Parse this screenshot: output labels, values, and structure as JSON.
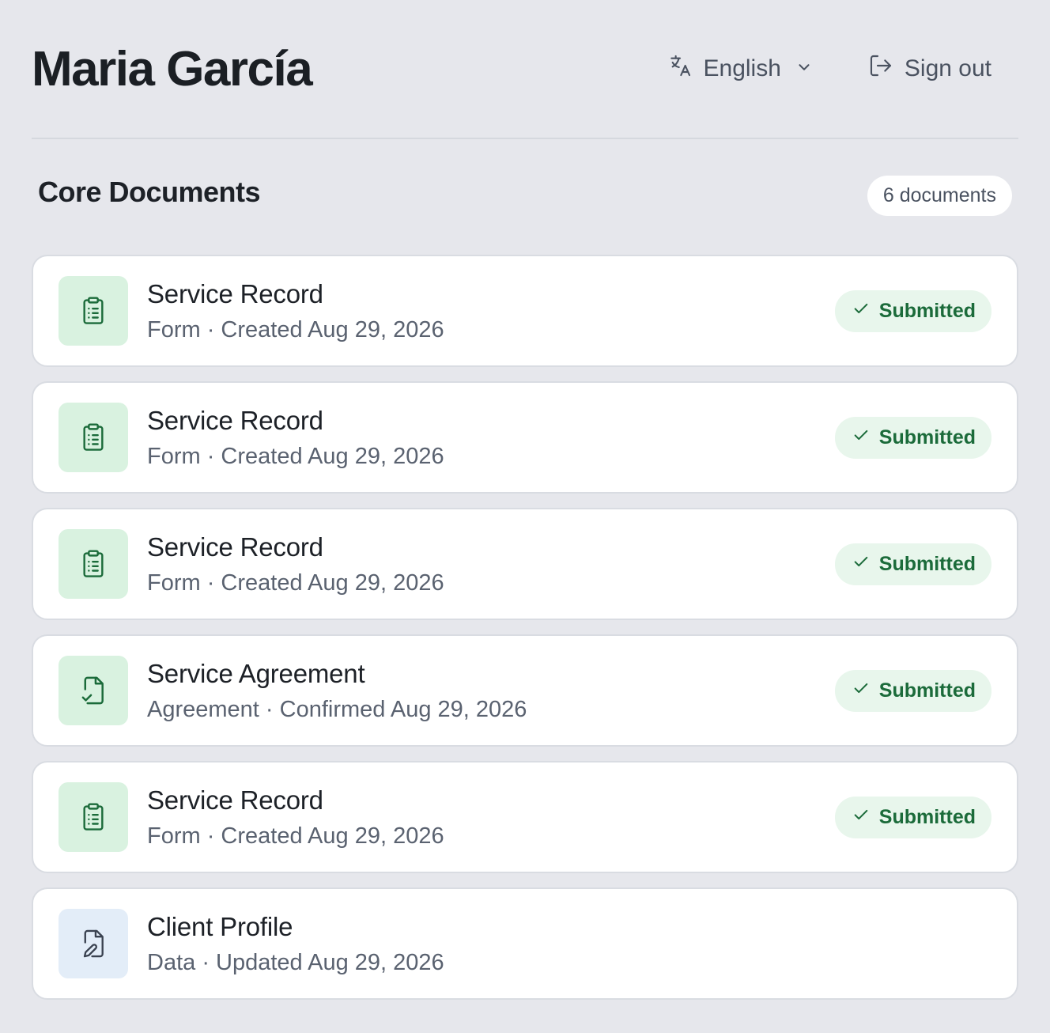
{
  "header": {
    "user_name": "Maria García",
    "language": "English",
    "sign_out_label": "Sign out"
  },
  "section": {
    "title": "Core Documents",
    "count_label": "6 documents"
  },
  "documents": [
    {
      "title": "Service Record",
      "meta": "Form · Created Aug 29, 2026",
      "status": "Submitted",
      "icon": "clipboard-list-icon"
    },
    {
      "title": "Service Record",
      "meta": "Form · Created Aug 29, 2026",
      "status": "Submitted",
      "icon": "clipboard-list-icon"
    },
    {
      "title": "Service Record",
      "meta": "Form · Created Aug 29, 2026",
      "status": "Submitted",
      "icon": "clipboard-list-icon"
    },
    {
      "title": "Service Agreement",
      "meta": "Agreement · Confirmed Aug 29, 2026",
      "status": "Submitted",
      "icon": "file-check-icon"
    },
    {
      "title": "Service Record",
      "meta": "Form · Created Aug 29, 2026",
      "status": "Submitted",
      "icon": "clipboard-list-icon"
    },
    {
      "title": "Client Profile",
      "meta": "Data · Updated Aug 29, 2026",
      "status": "",
      "icon": "file-pen-icon"
    }
  ],
  "colors": {
    "background": "#e6e7ec",
    "card": "#ffffff",
    "form_icon_bg": "#d9f2e0",
    "data_icon_bg": "#e3edf8",
    "success_text": "#1b6b3a",
    "success_bg": "#e8f6ec"
  }
}
